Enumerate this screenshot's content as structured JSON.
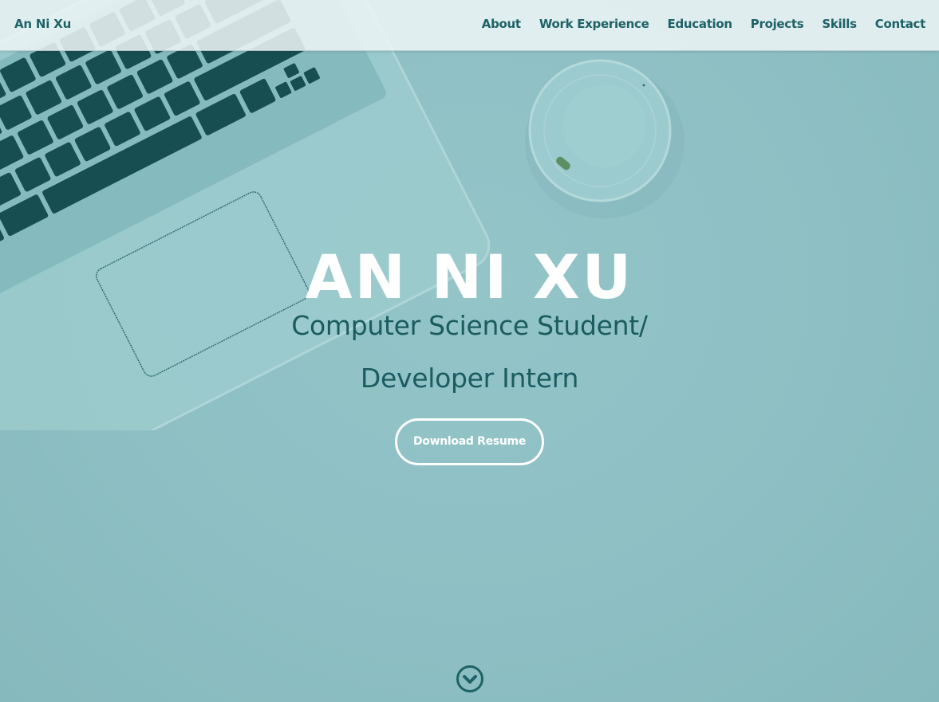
{
  "nav": {
    "brand": "An Ni Xu",
    "links": [
      "About",
      "Work Experience",
      "Education",
      "Projects",
      "Skills",
      "Contact"
    ]
  },
  "hero": {
    "name": "AN NI XU",
    "subtitle_line1": "Computer Science Student/",
    "subtitle_line2": "Developer Intern",
    "button_label": "Download Resume"
  },
  "icons": {
    "scroll": "chevron-down-circle-icon"
  },
  "colors": {
    "overlay": "#8cbfc4",
    "accent_text": "#1e6266",
    "white": "#ffffff"
  }
}
